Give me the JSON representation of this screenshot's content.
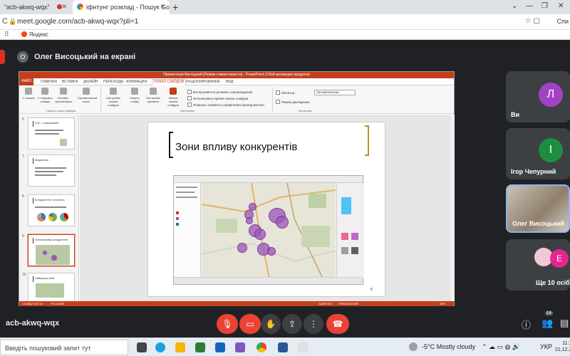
{
  "browser": {
    "tabs": [
      {
        "label": "“acb-akwq-wqx”",
        "recording": true
      },
      {
        "label": "іфнтунг розклад - Пошук Googl"
      }
    ],
    "new_tab": "+",
    "url": "meet.google.com/acb-akwq-wqx?pli=1",
    "profile_label": "Спи",
    "bookmark": "Яндекс"
  },
  "presenter": {
    "initial": "О",
    "text": "Олег Висоцький на екрані"
  },
  "powerpoint": {
    "window_title": "Презентація  Висоцький [Режим совместимости] - PowerPoint (Сбой активации продукта)",
    "ribbon_tabs": [
      "ФАЙЛ",
      "ГЛАВНАЯ",
      "ВСТАВКА",
      "ДИЗАЙН",
      "ПЕРЕХОДЫ",
      "АНИМАЦИЯ",
      "ПОКАЗ СЛАЙДОВ",
      "РЕЦЕНЗИРОВАНИЕ",
      "ВИД"
    ],
    "ribbon_buttons": [
      "С начала",
      "С текущего слайда",
      "Онлайн-презентация",
      "Произвольный показ",
      "Настройка показа слайдов",
      "Скрыть слайд",
      "Настройка времени",
      "Запись показа слайдов"
    ],
    "ribbon_groups": [
      "Начать показ слайдов",
      "Настройка",
      "Мониторы"
    ],
    "checkboxes": [
      "Воспроизвести речевое сопровождение",
      "Использовать время показа слайдов",
      "Показать элементы управления проигрывателя"
    ],
    "monitor_label": "Монитор:",
    "monitor_value": "Автоматически",
    "presenter_mode": "Режим докладчика",
    "thumbnails": [
      {
        "num": "6",
        "title": "ГОС. с мережевій"
      },
      {
        "num": "7",
        "title": "Маркетинг"
      },
      {
        "num": "8",
        "title": "Конкурентне оточення"
      },
      {
        "num": "9",
        "title": "Зони впливу конкурентів"
      },
      {
        "num": "10",
        "title": "Найкращі зони"
      }
    ],
    "slide_title": "Зони впливу конкурентів",
    "slide_page": "5",
    "status_left": "СЛАЙД 9 ИЗ 14",
    "status_lang": "РУССКИЙ",
    "status_notes": "ЗАМЕТКИ",
    "status_comments": "ПРИМЕЧАНИЯ",
    "zoom": "49%"
  },
  "participants": [
    {
      "initial": "Л",
      "name": "Ви",
      "color": "#a142c4"
    },
    {
      "initial": "І",
      "name": "Ігор Чепурний",
      "color": "#1e8e3e"
    },
    {
      "name": "Олег Висоцький"
    },
    {
      "initial": "Е",
      "name": "Ще 10 осіб",
      "color": "#e52592"
    }
  ],
  "meeting": {
    "code": "acb-akwq-wqx",
    "participant_count": "14"
  },
  "taskbar": {
    "search_placeholder": "Введіть пошуковий запит тут",
    "weather": "-5°C  Mostly cloudy",
    "lang": "УКР",
    "time": "11:1",
    "date": "21.12.2"
  }
}
